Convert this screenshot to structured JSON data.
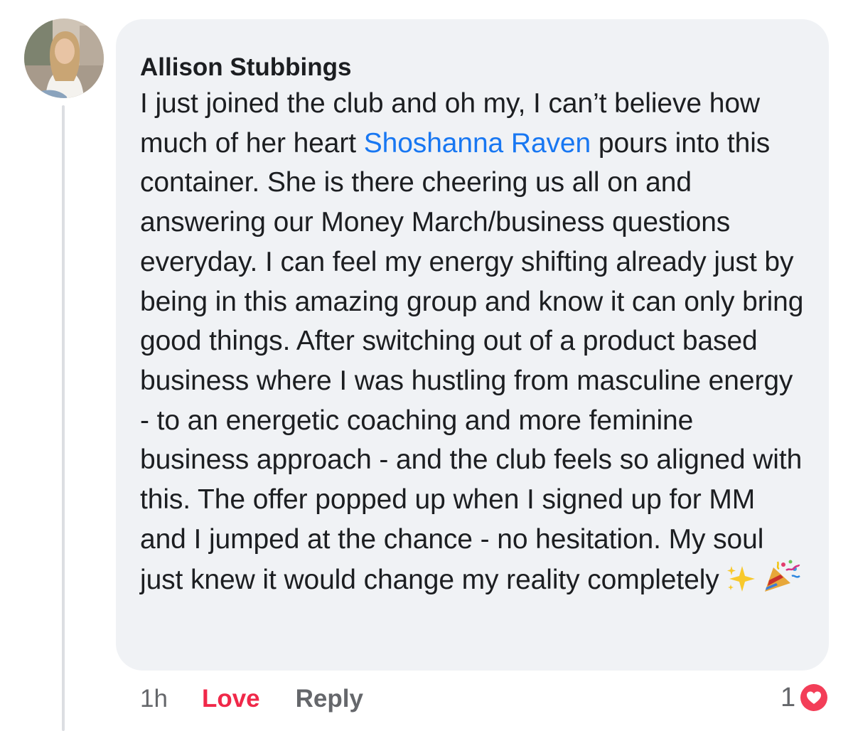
{
  "comment": {
    "author": "Allison Stubbings",
    "text_part1": "I just joined the club and oh my, I can’t believe how much of her heart ",
    "mention": "Shoshanna Raven",
    "text_part2": " pours into this container. She is there cheering us all on and answering our Money March/business questions everyday. I can feel my energy shifting already just by being in this amazing group and know it can only bring good things. After switching out of a product based business where I was hustling from masculine energy - to an energetic coaching and more feminine business approach - and the club feels so aligned with this. The offer popped up when I signed up for MM and I jumped at the chance - no hesitation. My soul just knew it would change my reality completely",
    "emojis": [
      "sparkles-emoji",
      "party-popper-emoji"
    ]
  },
  "actions": {
    "time": "1h",
    "love": "Love",
    "reply": "Reply"
  },
  "reactions": {
    "count": "1",
    "icon": "heart-icon"
  },
  "colors": {
    "bubble": "#f0f2f5",
    "mention": "#1877f2",
    "love": "#f02849",
    "muted": "#65676b"
  }
}
